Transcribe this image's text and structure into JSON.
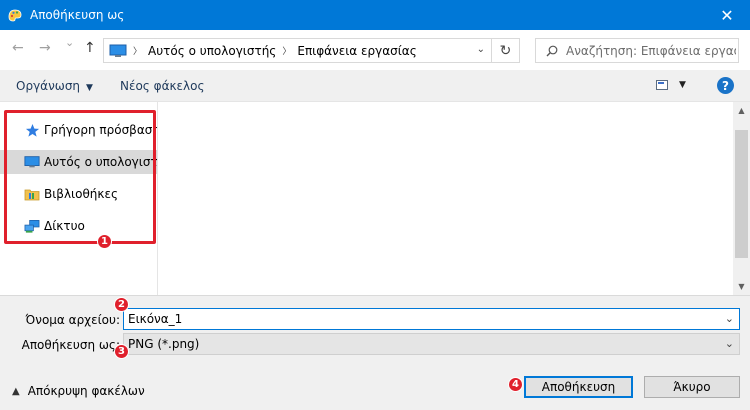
{
  "window": {
    "title": "Αποθήκευση ως",
    "close_glyph": "✕"
  },
  "nav": {
    "back_glyph": "←",
    "forward_glyph": "→",
    "recent_glyph": "⌄",
    "up_glyph": "↑",
    "breadcrumbs": [
      "Αυτός ο υπολογιστής",
      "Επιφάνεια εργασίας"
    ],
    "refresh_glyph": "↻",
    "search_placeholder": "Αναζήτηση: Επιφάνεια εργασίας"
  },
  "toolbar": {
    "organize_label": "Οργάνωση",
    "new_folder_label": "Νέος φάκελος",
    "help_label": "?"
  },
  "sidebar": {
    "items": [
      {
        "label": "Γρήγορη πρόσβαση",
        "icon": "star-icon",
        "selected": false
      },
      {
        "label": "Αυτός ο υπολογιστής",
        "icon": "computer-icon",
        "selected": true
      },
      {
        "label": "Βιβλιοθήκες",
        "icon": "libraries-icon",
        "selected": false
      },
      {
        "label": "Δίκτυο",
        "icon": "network-icon",
        "selected": false
      }
    ]
  },
  "form": {
    "filename_label": "Όνομα αρχείου:",
    "filename_value": "Εικόνα_1",
    "filetype_label": "Αποθήκευση ως:",
    "filetype_value": "PNG (*.png)"
  },
  "footer": {
    "hide_folders_label": "Απόκρυψη φακέλων",
    "save_label": "Αποθήκευση",
    "cancel_label": "Άκυρο"
  },
  "annotations": {
    "badges": [
      "1",
      "2",
      "3",
      "4"
    ]
  },
  "colors": {
    "titlebar": "#0078d7",
    "highlight": "#e0202c",
    "focus": "#0078d7"
  }
}
